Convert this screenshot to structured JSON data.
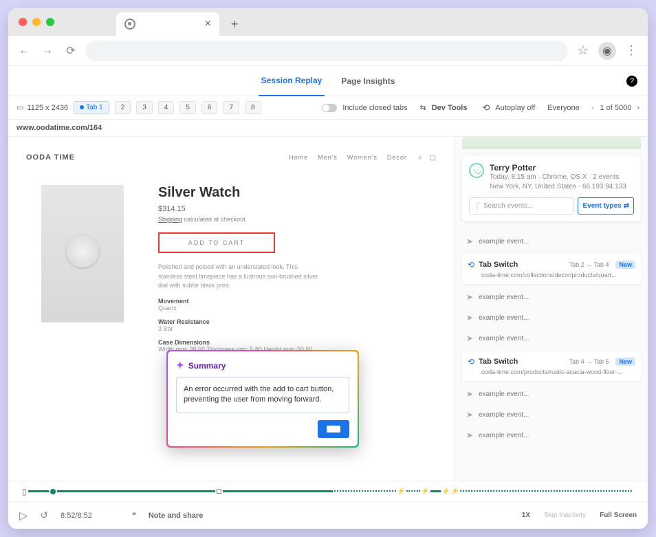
{
  "toolbar": {
    "dimensions": "1125 x 2436",
    "tabs": [
      "Tab 1",
      "2",
      "3",
      "4",
      "5",
      "6",
      "7",
      "8"
    ],
    "include_closed": "Include closed tabs",
    "dev_tools": "Dev Tools",
    "autoplay": "Autoplay off",
    "audience": "Everyone",
    "pagination": "1 of 5000"
  },
  "url": "www.oodatime.com/164",
  "nav_tabs": {
    "replay": "Session Replay",
    "insights": "Page Insights"
  },
  "store": {
    "brand": "OODA TIME",
    "nav": [
      "Home",
      "Men's",
      "Women's",
      "Decor"
    ],
    "product_title": "Silver Watch",
    "price": "$314.15",
    "shipping_label": "Shipping",
    "shipping_rest": " calculated at checkout.",
    "add_to_cart": "ADD TO CART",
    "description": "Polished and poised with an understated look. This stainless steel timepiece has a lustrous sun-brushed silver dial with subtle black print.",
    "specs": {
      "movement_label": "Movement",
      "movement_value": "Quartz",
      "water_label": "Water Resistance",
      "water_value": "3 Bar",
      "case_label": "Case Dimensions",
      "case_value": "Width mm: 38.00    Thickness mm: 5.80    Height mm: 50.60"
    }
  },
  "summary": {
    "title": "Summary",
    "body": "An error occurred with the add to cart button, preventing the user from moving forward."
  },
  "user": {
    "name": "Terry Potter",
    "meta1": "Today, 8:15 am · Chrome, OS X · 2 events",
    "meta2": "New York, NY, United States · 66.193.94.133",
    "search_placeholder": "Search events...",
    "event_types": "Event types"
  },
  "events": {
    "example": "example event...",
    "tab_switch": "Tab Switch",
    "ts1_tabs": "Tab 2  →  Tab 4",
    "ts1_url": "ooda-time.com/collections/decor/products/quart...",
    "ts2_tabs": "Tab 4  →  Tab 5",
    "ts2_url": "ooda-time.com/products/rustic-acacia-wood-floor-...",
    "new_badge": "New"
  },
  "controls": {
    "time": "8:52/8:52",
    "note": "Note and share",
    "speed": "1X",
    "skip": "Skip Inactivity",
    "fullscreen": "Full Screen"
  }
}
